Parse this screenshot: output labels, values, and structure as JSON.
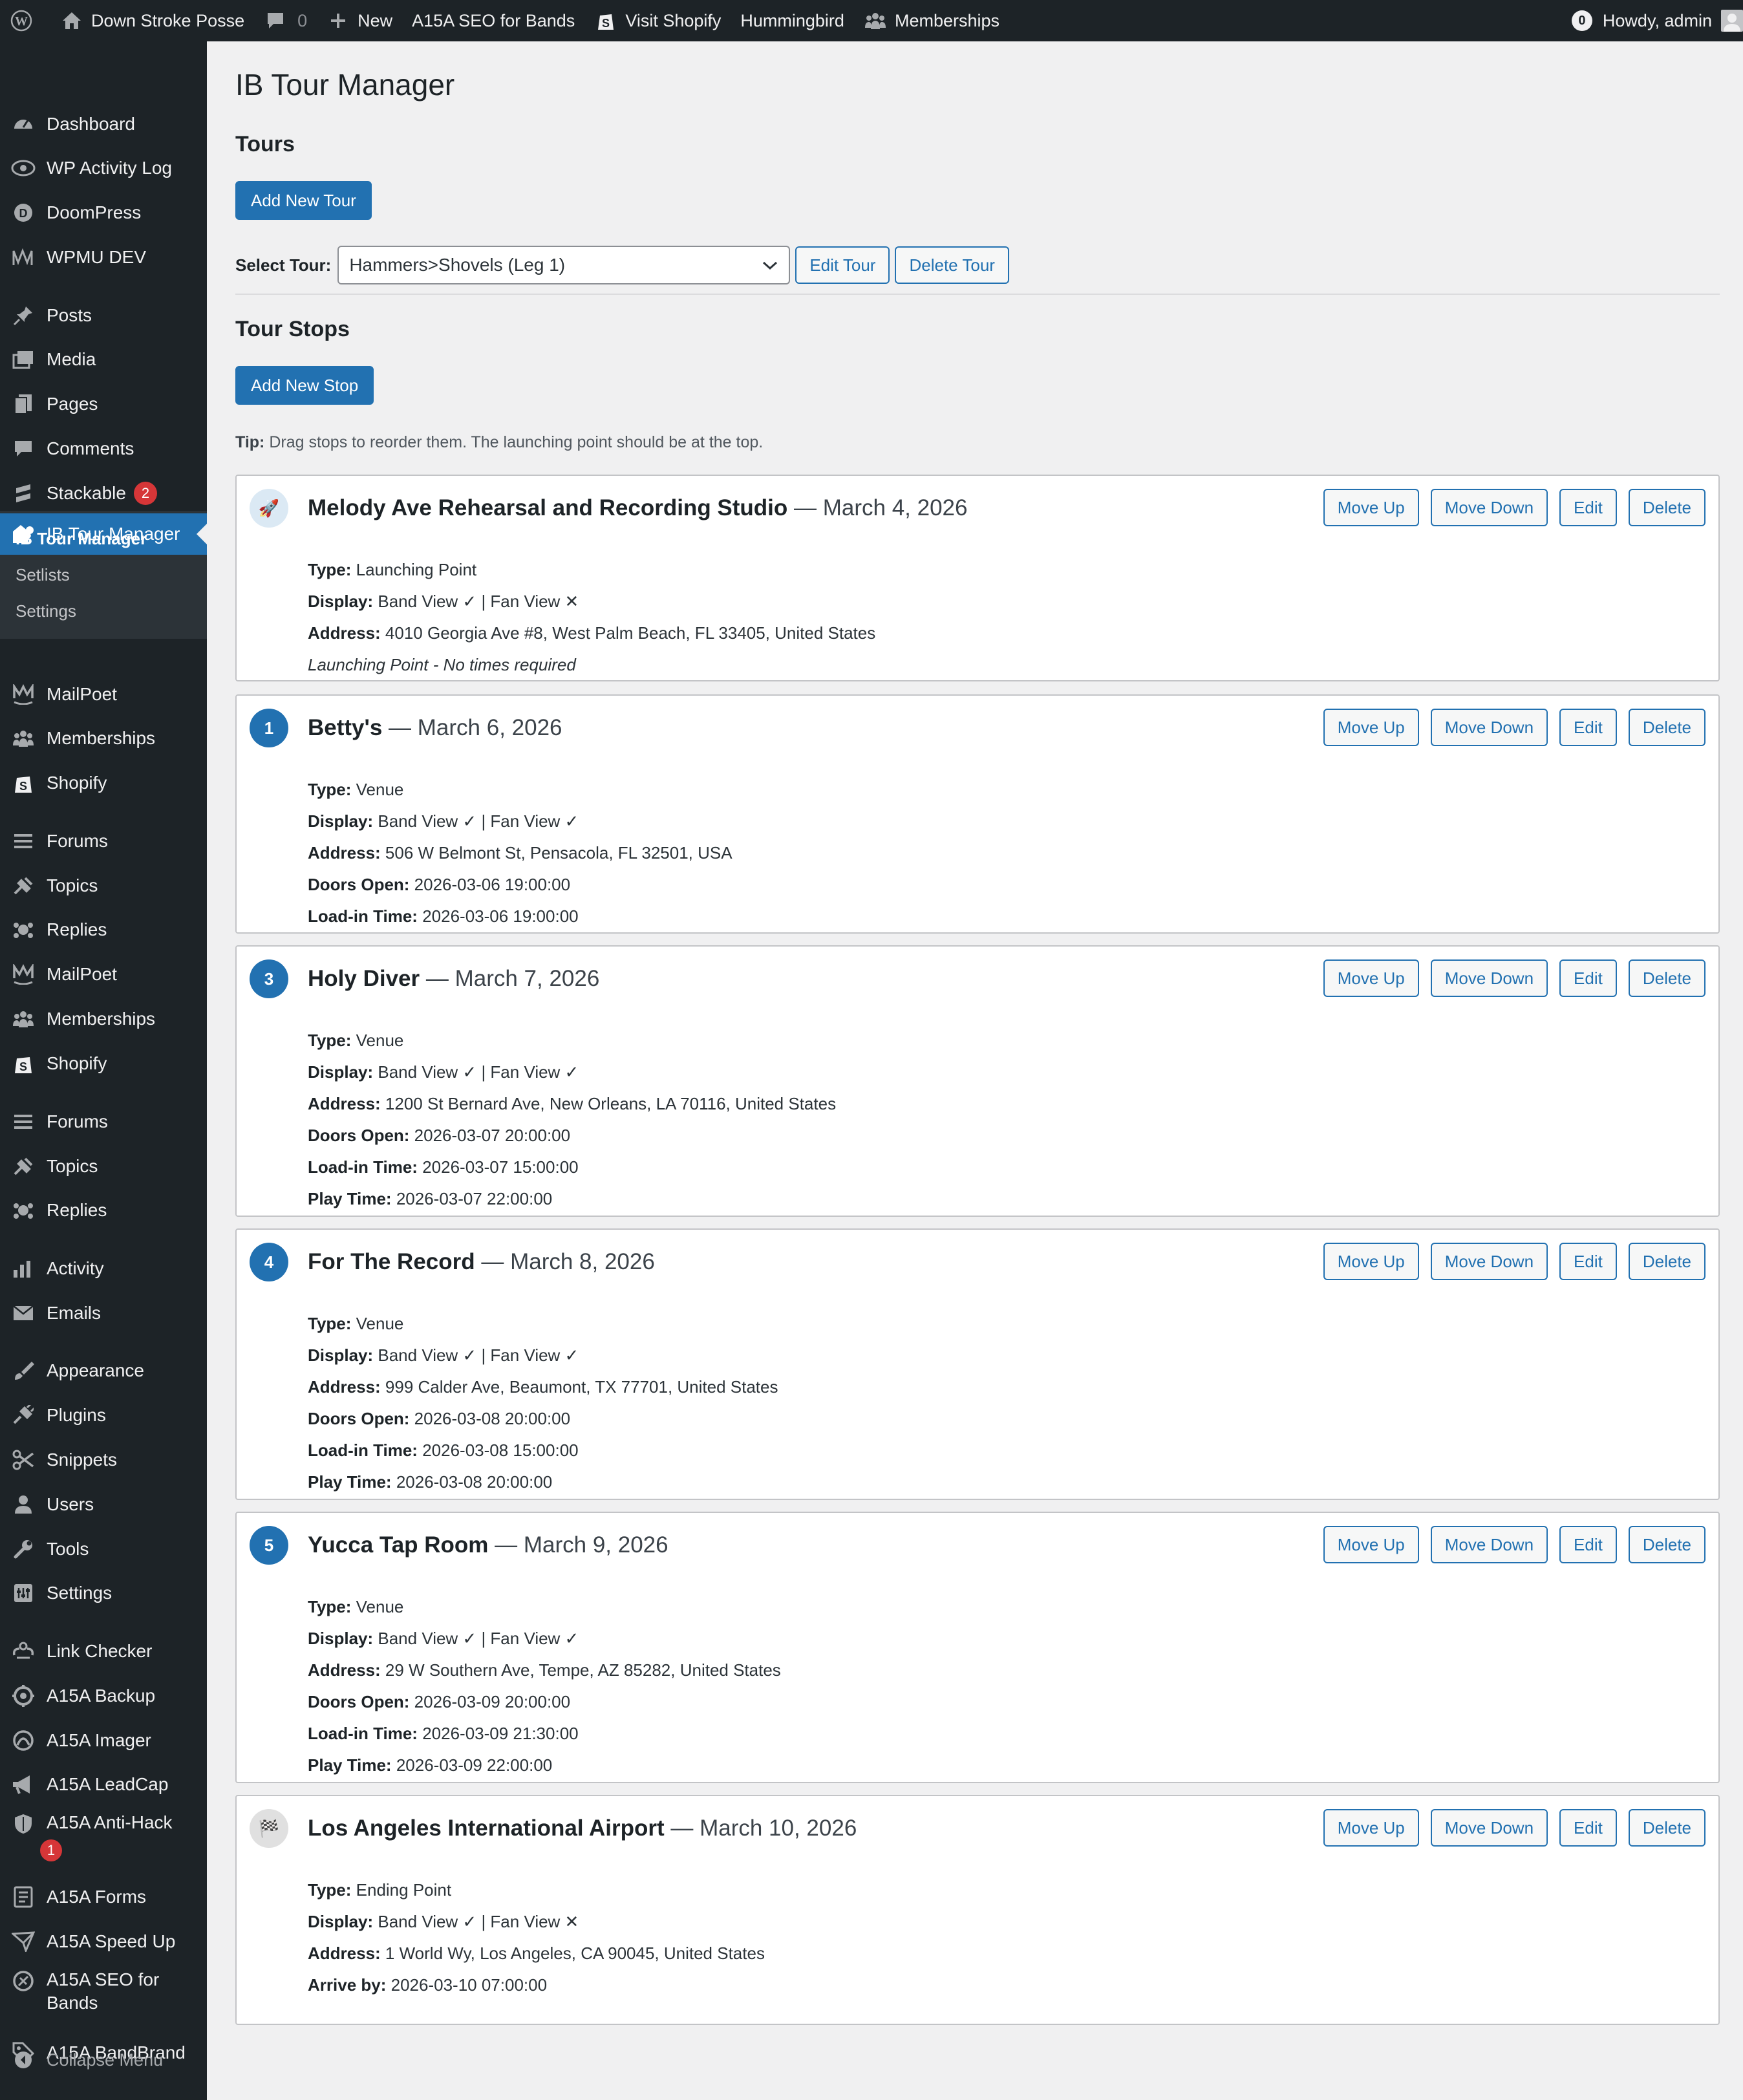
{
  "adminbar": {
    "site_name": "Down Stroke Posse",
    "comments_count": "0",
    "new_label": "New",
    "seo_label": "A15A SEO for Bands",
    "visit_shopify": "Visit Shopify",
    "hummingbird": "Hummingbird",
    "memberships": "Memberships",
    "notif_count": "0",
    "howdy": "Howdy, admin"
  },
  "sidebar": {
    "items": [
      {
        "label": "Dashboard",
        "icon": "dashboard-icon"
      },
      {
        "label": "WP Activity Log",
        "icon": "eye-icon"
      },
      {
        "label": "DoomPress",
        "icon": "doompress-icon"
      },
      {
        "label": "WPMU DEV",
        "icon": "wpmudev-icon"
      },
      {
        "label": "Posts",
        "icon": "pin-icon"
      },
      {
        "label": "Media",
        "icon": "media-icon"
      },
      {
        "label": "Pages",
        "icon": "pages-icon"
      },
      {
        "label": "Comments",
        "icon": "comment-icon"
      },
      {
        "label": "Stackable",
        "icon": "stackable-icon",
        "badge": "2"
      },
      {
        "label": "IB Tour Manager",
        "icon": "tour-icon"
      },
      {
        "label": "MailPoet",
        "icon": "mailpoet-icon"
      },
      {
        "label": "Memberships",
        "icon": "groups-icon"
      },
      {
        "label": "Shopify",
        "icon": "shopify-icon"
      },
      {
        "label": "Forums",
        "icon": "forums-icon"
      },
      {
        "label": "Topics",
        "icon": "topics-icon"
      },
      {
        "label": "Replies",
        "icon": "replies-icon"
      },
      {
        "label": "MailPoet",
        "icon": "mailpoet-icon"
      },
      {
        "label": "Memberships",
        "icon": "groups-icon"
      },
      {
        "label": "Shopify",
        "icon": "shopify-icon"
      },
      {
        "label": "Forums",
        "icon": "forums-icon"
      },
      {
        "label": "Topics",
        "icon": "topics-icon"
      },
      {
        "label": "Replies",
        "icon": "replies-icon"
      },
      {
        "label": "Activity",
        "icon": "activity-icon"
      },
      {
        "label": "Emails",
        "icon": "email-icon"
      },
      {
        "label": "Appearance",
        "icon": "appearance-icon"
      },
      {
        "label": "Plugins",
        "icon": "plugins-icon"
      },
      {
        "label": "Snippets",
        "icon": "scissors-icon"
      },
      {
        "label": "Users",
        "icon": "users-icon"
      },
      {
        "label": "Tools",
        "icon": "wrench-icon"
      },
      {
        "label": "Settings",
        "icon": "settings-icon"
      },
      {
        "label": "Link Checker",
        "icon": "link-icon"
      },
      {
        "label": "A15A Backup",
        "icon": "backup-icon"
      },
      {
        "label": "A15A Imager",
        "icon": "imager-icon"
      },
      {
        "label": "A15A LeadCap",
        "icon": "megaphone-icon"
      },
      {
        "label": "A15A Anti-Hack",
        "icon": "shield-icon",
        "badge": "1"
      },
      {
        "label": "A15A Forms",
        "icon": "forms-icon"
      },
      {
        "label": "A15A Speed Up",
        "icon": "speed-icon"
      },
      {
        "label": "A15A SEO for",
        "label2": "Bands",
        "icon": "seo-icon"
      },
      {
        "label": "A15A BandBrand",
        "icon": "tag-icon"
      }
    ],
    "submenu": [
      "IB Tour Manager",
      "Setlists",
      "Settings"
    ],
    "collapse": "Collapse Menu"
  },
  "page": {
    "title": "IB Tour Manager",
    "tours_heading": "Tours",
    "add_tour": "Add New Tour",
    "select_label": "Select Tour:",
    "selected_tour": "Hammers>Shovels (Leg 1)",
    "edit_tour": "Edit Tour",
    "delete_tour": "Delete Tour",
    "stops_heading": "Tour Stops",
    "add_stop": "Add New Stop",
    "tip_label": "Tip:",
    "tip_text": " Drag stops to reorder them. The launching point should be at the top."
  },
  "actions": {
    "move_up": "Move Up",
    "move_down": "Move Down",
    "edit": "Edit",
    "delete": "Delete"
  },
  "stops": [
    {
      "marker": "🚀",
      "name": "Melody Ave Rehearsal and Recording Studio",
      "date": " — March 4, 2026",
      "lines": [
        {
          "k": "Type:",
          "v": " Launching Point"
        },
        {
          "k": "Display:",
          "v": " Band View ✓  |  Fan View ✕"
        },
        {
          "k": "Address:",
          "v": " 4010 Georgia Ave #8, West Palm Beach, FL 33405, United States"
        },
        {
          "note": "Launching Point - No times required"
        }
      ]
    },
    {
      "marker": "1",
      "name": "Betty's",
      "date": " — March 6, 2026",
      "lines": [
        {
          "k": "Type:",
          "v": " Venue"
        },
        {
          "k": "Display:",
          "v": " Band View ✓  |  Fan View ✓"
        },
        {
          "k": "Address:",
          "v": " 506 W Belmont St, Pensacola, FL 32501, USA"
        },
        {
          "k": "Doors Open:",
          "v": " 2026-03-06 19:00:00"
        },
        {
          "k": "Load-in Time:",
          "v": " 2026-03-06 19:00:00"
        }
      ]
    },
    {
      "marker": "3",
      "name": "Holy Diver",
      "date": " — March 7, 2026",
      "lines": [
        {
          "k": "Type:",
          "v": " Venue"
        },
        {
          "k": "Display:",
          "v": " Band View ✓  |  Fan View ✓"
        },
        {
          "k": "Address:",
          "v": " 1200 St Bernard Ave, New Orleans, LA 70116, United States"
        },
        {
          "k": "Doors Open:",
          "v": " 2026-03-07 20:00:00"
        },
        {
          "k": "Load-in Time:",
          "v": " 2026-03-07 15:00:00"
        },
        {
          "k": "Play Time:",
          "v": " 2026-03-07 22:00:00"
        }
      ]
    },
    {
      "marker": "4",
      "name": "For The Record",
      "date": " — March 8, 2026",
      "lines": [
        {
          "k": "Type:",
          "v": " Venue"
        },
        {
          "k": "Display:",
          "v": " Band View ✓  |  Fan View ✓"
        },
        {
          "k": "Address:",
          "v": " 999 Calder Ave, Beaumont, TX 77701, United States"
        },
        {
          "k": "Doors Open:",
          "v": " 2026-03-08 20:00:00"
        },
        {
          "k": "Load-in Time:",
          "v": " 2026-03-08 15:00:00"
        },
        {
          "k": "Play Time:",
          "v": " 2026-03-08 20:00:00"
        }
      ]
    },
    {
      "marker": "5",
      "name": "Yucca Tap Room",
      "date": " — March 9, 2026",
      "lines": [
        {
          "k": "Type:",
          "v": " Venue"
        },
        {
          "k": "Display:",
          "v": " Band View ✓  |  Fan View ✓"
        },
        {
          "k": "Address:",
          "v": " 29 W Southern Ave, Tempe, AZ 85282, United States"
        },
        {
          "k": "Doors Open:",
          "v": " 2026-03-09 20:00:00"
        },
        {
          "k": "Load-in Time:",
          "v": " 2026-03-09 21:30:00"
        },
        {
          "k": "Play Time:",
          "v": " 2026-03-09 22:00:00"
        }
      ]
    },
    {
      "marker": "🏁",
      "name": "Los Angeles International Airport",
      "date": " — March 10, 2026",
      "lines": [
        {
          "k": "Type:",
          "v": " Ending Point"
        },
        {
          "k": "Display:",
          "v": " Band View ✓  |  Fan View ✕"
        },
        {
          "k": "Address:",
          "v": " 1 World Wy, Los Angeles, CA 90045, United States"
        },
        {
          "k": "Arrive by:",
          "v": " 2026-03-10 07:00:00"
        }
      ]
    }
  ],
  "colors": {
    "accent": "#2271b1",
    "sidebar": "#1d2327",
    "badge": "#d63638"
  }
}
